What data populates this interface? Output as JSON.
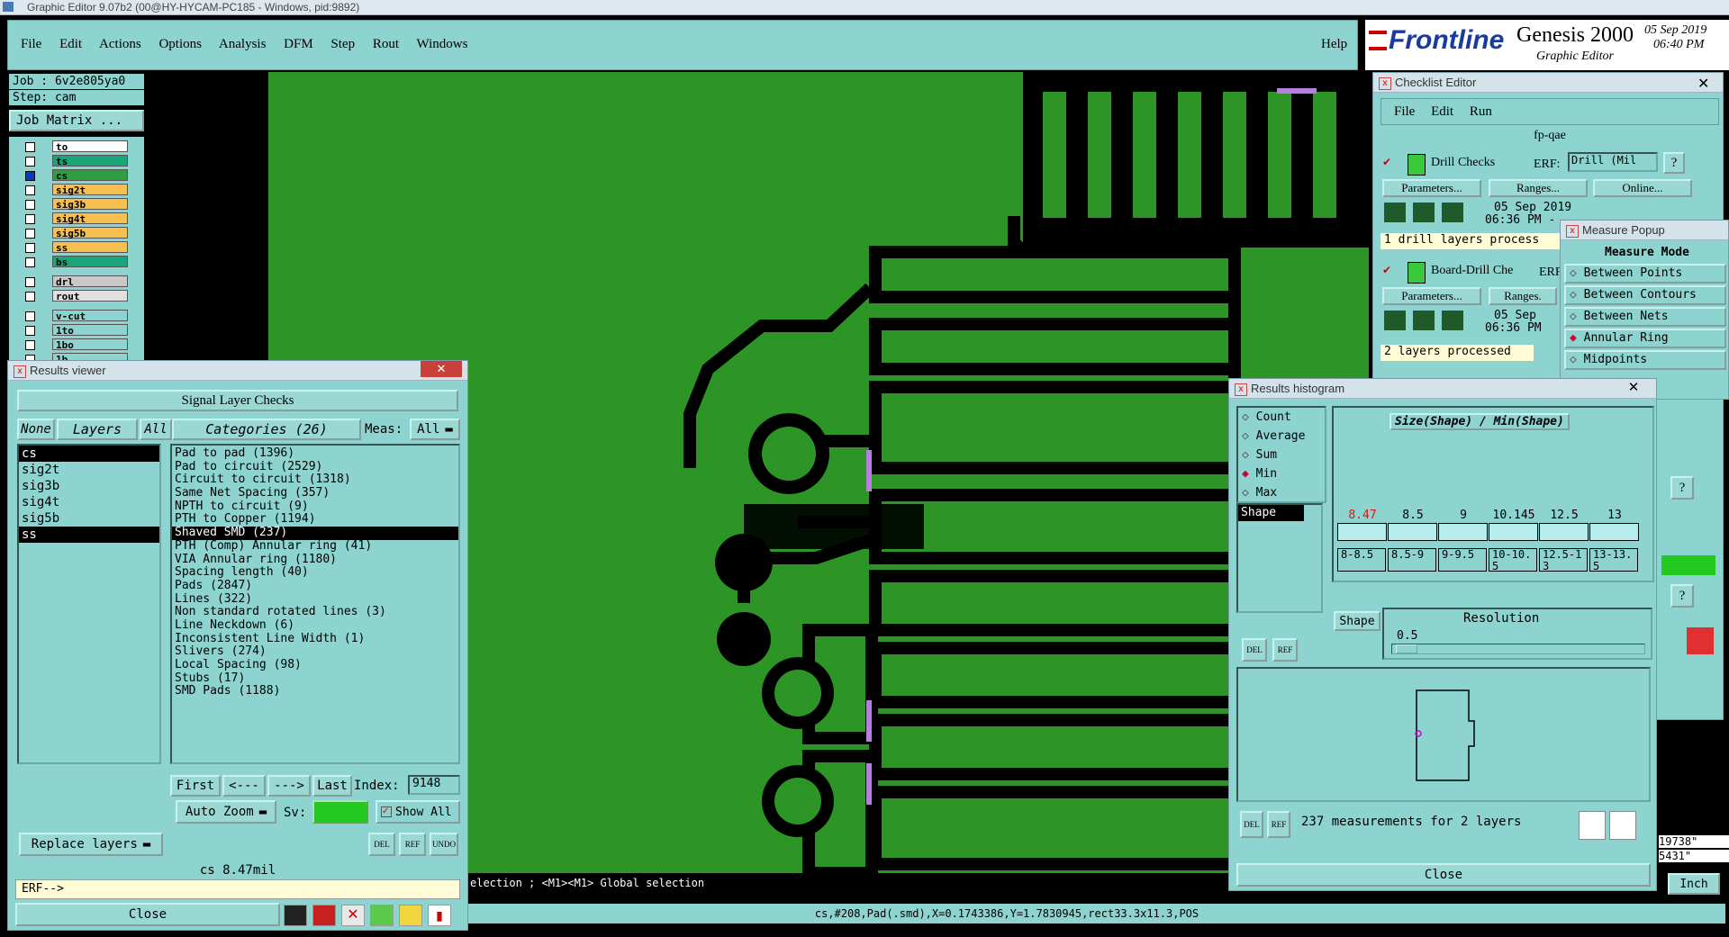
{
  "titlebar": {
    "text": "Graphic Editor 9.07b2 (00@HY-HYCAM-PC185 - Windows, pid:9892)"
  },
  "menubar": {
    "items": [
      "File",
      "Edit",
      "Actions",
      "Options",
      "Analysis",
      "DFM",
      "Step",
      "Rout",
      "Windows"
    ],
    "help": "Help"
  },
  "brand": {
    "logo": "Frontline",
    "product": "Genesis 2000",
    "subtitle": "Graphic Editor",
    "date": "05 Sep 2019",
    "time": "06:40 PM"
  },
  "job": {
    "job_label": "Job : 6v2e805ya0",
    "step_label": "Step: cam",
    "matrix_button": "Job Matrix ..."
  },
  "layers": [
    {
      "name": "to",
      "color": "#ffffff"
    },
    {
      "name": "ts",
      "color": "#1aa67a"
    },
    {
      "name": "cs",
      "color": "#2e9e3e"
    },
    {
      "name": "sig2t",
      "color": "#f5c050"
    },
    {
      "name": "sig3b",
      "color": "#f5c050"
    },
    {
      "name": "sig4t",
      "color": "#f5c050"
    },
    {
      "name": "sig5b",
      "color": "#f5c050"
    },
    {
      "name": "ss",
      "color": "#f5c050"
    },
    {
      "name": "bs",
      "color": "#1aa67a"
    },
    {
      "name": "drl",
      "color": "#c8c8c8"
    },
    {
      "name": "rout",
      "color": "#e0e0e0"
    },
    {
      "name": "v-cut",
      "color": "#8dd3cf"
    },
    {
      "name": "1to",
      "color": "#8dd3cf"
    },
    {
      "name": "1bo",
      "color": "#8dd3cf"
    },
    {
      "name": "1b",
      "color": "#8dd3cf"
    }
  ],
  "results_viewer": {
    "title": "Results viewer",
    "header": "Signal Layer Checks",
    "none_btn": "None",
    "layers_btn": "Layers",
    "all_btn": "All",
    "categories_btn": "Categories (26)",
    "meas_label": "Meas:",
    "meas_value": "All",
    "layer_list": [
      "cs",
      "sig2t",
      "sig3b",
      "sig4t",
      "sig5b",
      "ss"
    ],
    "categories": [
      "Pad to pad (1396)",
      "Pad to circuit (2529)",
      "Circuit to circuit (1318)",
      "Same Net Spacing (357)",
      "NPTH to circuit (9)",
      "PTH to Copper (1194)",
      "Shaved SMD (237)",
      "PTH (Comp) Annular ring (41)",
      "VIA Annular ring (1180)",
      "Spacing length (40)",
      "Pads (2847)",
      "Lines (322)",
      "Non standard rotated lines (3)",
      "Line Neckdown (6)",
      "Inconsistent Line Width (1)",
      "Slivers (274)",
      "Local Spacing (98)",
      "Stubs (17)",
      "SMD Pads (1188)"
    ],
    "selected_category": "Shaved SMD (237)",
    "nav": {
      "first": "First",
      "prev": "<---",
      "next": "--->",
      "last": "Last",
      "index_label": "Index:",
      "index_value": "9148"
    },
    "autozoom": "Auto Zoom",
    "sv_label": "Sv:",
    "show_all": "Show All",
    "replace_layers": "Replace layers",
    "status": "cs 8.47mil",
    "erf_prompt": "ERF-->",
    "close": "Close",
    "small_btns": [
      "DEL",
      "REF",
      "UNDO"
    ]
  },
  "checklist": {
    "title": "Checklist Editor",
    "menu": [
      "File",
      "Edit",
      "Run"
    ],
    "name": "fp-qae",
    "check1": {
      "name": "Drill Checks",
      "erf": "ERF:",
      "erf_value": "Drill (Mil",
      "params": "Parameters...",
      "ranges": "Ranges...",
      "online": "Online...",
      "date": "05 Sep 2019",
      "time": "06:36 PM -",
      "status": "1 drill layers process"
    },
    "check2": {
      "name": "Board-Drill Che",
      "erf": "ERF",
      "params": "Parameters...",
      "ranges": "Ranges.",
      "date": "05 Sep",
      "time": "06:36 PM",
      "status": "2 layers processed"
    },
    "help": "?"
  },
  "measure_popup": {
    "title": "Measure Popup",
    "mode": "Measure Mode",
    "options": [
      "Between Points",
      "Between Contours",
      "Between Nets",
      "Annular Ring",
      "Midpoints"
    ],
    "selected": "Annular Ring"
  },
  "histogram": {
    "title": "Results histogram",
    "stats": [
      "Count",
      "Average",
      "Sum",
      "Min",
      "Max"
    ],
    "selected_stat": "Min",
    "shape_label": "Shape",
    "chart_title": "Size(Shape) / Min(Shape)",
    "bar_values": [
      "8.47",
      "8.5",
      "9",
      "10.145",
      "12.5",
      "13"
    ],
    "bins": [
      "8-8.5",
      "8.5-9",
      "9-9.5",
      "10-10.5",
      "12.5-13",
      "13-13.5"
    ],
    "resolution_label": "Resolution",
    "resolution_value": "0.5",
    "shape_btn": "Shape",
    "summary": "237 measurements for 2 layers",
    "close": "Close",
    "small_btns": [
      "DEL",
      "REF"
    ]
  },
  "status_bar": {
    "hint": "election ; <M1><M1> Global selection",
    "info": "cs,#208,Pad(.smd),X=0.1743386,Y=1.7830945,rect33.3x11.3,POS",
    "coord1": "19738\"",
    "coord2": "5431\"",
    "units": "Inch"
  }
}
